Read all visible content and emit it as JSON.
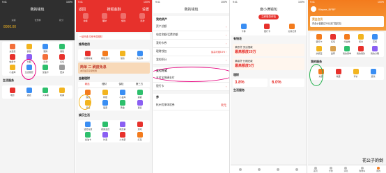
{
  "colors": {
    "accent_red": "#e7312c",
    "orange": "#f37b1d",
    "gold": "#d8a04e",
    "circle_pink": "#e6007e",
    "circle_green": "#22b14c",
    "dark": "#2f2f2f"
  },
  "panel1": {
    "title": "我的钱包",
    "stats": [
      {
        "value": "0.00",
        "label": "余额"
      },
      {
        "value": "2",
        "label": "优惠券"
      },
      {
        "value": "561",
        "label": "积分"
      }
    ],
    "balance": "8000.00",
    "grid": [
      {
        "label": "充话费",
        "icon": "phone-icon",
        "color": "#f36f3a"
      },
      {
        "label": "借钱",
        "icon": "money-icon",
        "color": "#f2b41f"
      },
      {
        "label": "理财",
        "icon": "chart-icon",
        "color": "#3a8ef3"
      },
      {
        "label": "保险",
        "icon": "shield-icon",
        "color": "#2dbf6c"
      },
      {
        "label": "信用卡",
        "icon": "card-icon",
        "color": "#e7312c"
      },
      {
        "label": "分期",
        "icon": "clock-icon",
        "color": "#8a5ff2"
      },
      {
        "label": "还款",
        "icon": "return-icon",
        "color": "#f36f3a"
      },
      {
        "label": "红包",
        "icon": "gift-icon",
        "color": "#e7312c"
      },
      {
        "label": "小金库",
        "icon": "vault-icon",
        "color": "#f2b41f"
      },
      {
        "label": "生活缴费",
        "icon": "bill-icon",
        "color": "#3a8ef3"
      },
      {
        "label": "加油卡",
        "icon": "fuel-icon",
        "color": "#2dbf6c"
      },
      {
        "label": "更多",
        "icon": "more-icon",
        "color": "#999999"
      }
    ],
    "section": "生活服务",
    "services": [
      {
        "label": "电影",
        "color": "#e7312c"
      },
      {
        "label": "酒店",
        "color": "#3a8ef3"
      },
      {
        "label": "火车票",
        "color": "#2dbf6c"
      },
      {
        "label": "机票",
        "color": "#f2b41f"
      }
    ]
  },
  "panel2": {
    "back": "返回",
    "title": "搜狐金融",
    "settings": "设置",
    "top_icons": [
      "余额",
      "理财",
      "借钱",
      "还款"
    ],
    "promo": "一键开通 享受专属理财",
    "section1": "推荐使用",
    "row1": [
      "分期商城",
      "刷脸支付",
      "借款",
      "免息券"
    ],
    "banner": "简单 二 刷度免息",
    "banner_sub": "本月最高享受优惠",
    "section2": "金融理财",
    "tabs": [
      "精选",
      "理财",
      "保险",
      "第三方"
    ],
    "row2": [
      "借钱",
      "转账",
      "小金库",
      "提额"
    ],
    "row3": [
      "基金",
      "股票",
      "黄金",
      "更多"
    ],
    "section3": "娱乐生活",
    "row4": [
      "话费充值",
      "视频会员",
      "电影票",
      "游戏"
    ],
    "row5": [
      "加油卡",
      "外卖",
      "火车票",
      "红包"
    ]
  },
  "panel3": {
    "title": "我的钱包",
    "section_assets": "我的资产",
    "rows": [
      {
        "label": "资产总额",
        "value": ""
      },
      {
        "label": "电信余额/话费余额",
        "value": ""
      },
      {
        "label": "我的卡券",
        "value": ""
      },
      {
        "label": "理财钱包",
        "value": "最高可赚5.5%"
      },
      {
        "label": "我的积分",
        "value": ""
      }
    ],
    "section_pay": "支付方式",
    "pay_rows": [
      {
        "label": "支付宝快捷支付",
        "value": ""
      },
      {
        "label": "银行卡",
        "value": ""
      }
    ],
    "section_ticket": "券",
    "ticket": "杭州优享体验券",
    "ticket_value": "8元"
  },
  "panel4": {
    "title": "度小满钱包",
    "login": "立即登录体验",
    "quick": [
      "卡券",
      "银行卡",
      "交易记录"
    ],
    "section": "有钱花",
    "loan1_title": "满意贷·灵活借款",
    "loan1_amount": "最高额度20万",
    "loan2_title": "满易贷·分期还款",
    "loan2_amount": "最高额度5万",
    "section2": "理财",
    "rate1": "3.8%",
    "rate2": "6.0%",
    "section3": "生活服务"
  },
  "panel5": {
    "user": "Wayne_BFBF",
    "vip_title": "黄金会员",
    "vip_sub": "内含价值超过30元无门槛红包",
    "grid": [
      {
        "label": "银行卡",
        "color": "#f37b1d"
      },
      {
        "label": "红包",
        "color": "#e7312c"
      },
      {
        "label": "代金券",
        "color": "#f37b1d"
      },
      {
        "label": "积分",
        "color": "#f2b41f"
      },
      {
        "label": "花呗",
        "color": "#3a8ef3"
      },
      {
        "label": "余额宝",
        "color": "#f2b41f"
      },
      {
        "label": "鑫转",
        "color": "#d8a04e"
      },
      {
        "label": "我的保单",
        "color": "#2dbf6c"
      },
      {
        "label": "我的借款",
        "color": "#e7312c"
      },
      {
        "label": "我的分期",
        "color": "#8a5ff2"
      }
    ],
    "section": "我的服务",
    "services": [
      {
        "label": "充值",
        "color": "#f37b1d"
      },
      {
        "label": "收藏",
        "color": "#e7312c"
      },
      {
        "label": "评价",
        "color": "#f2b41f"
      },
      {
        "label": "退款",
        "color": "#3a8ef3"
      }
    ],
    "tabs": [
      "首页",
      "分类",
      "消息",
      "购物车",
      "我的"
    ],
    "watermark": "花公子的剑"
  }
}
